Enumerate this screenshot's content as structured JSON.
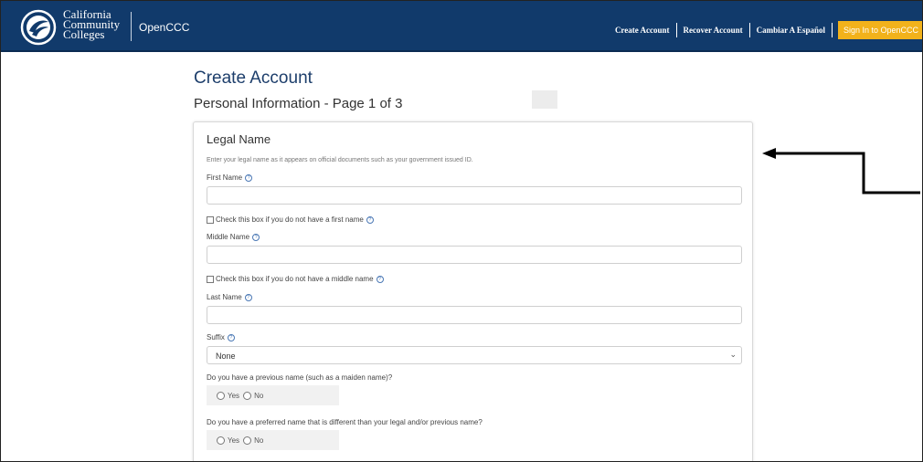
{
  "header": {
    "logo_lines": [
      "California",
      "Community",
      "Colleges"
    ],
    "app_name": "OpenCCC",
    "nav": {
      "create_account": "Create Account",
      "recover_account": "Recover Account",
      "spanish": "Cambiar A Español",
      "sign_in": "Sign In to OpenCCC"
    }
  },
  "page": {
    "title": "Create Account",
    "subtitle": "Personal Information - Page 1 of 3"
  },
  "form": {
    "section_title": "Legal Name",
    "hint": "Enter your legal name as it appears on official documents such as your government issued ID.",
    "first_name_label": "First Name",
    "first_name_value": "",
    "no_first_name_label": "Check this box if you do not have a first name",
    "middle_name_label": "Middle Name",
    "middle_name_value": "",
    "no_middle_name_label": "Check this box if you do not have a middle name",
    "last_name_label": "Last Name",
    "last_name_value": "",
    "suffix_label": "Suffix",
    "suffix_value": "None",
    "previous_name_question": "Do you have a previous name (such as a maiden name)?",
    "preferred_name_question": "Do you have a preferred name that is different than your legal and/or previous name?",
    "yes_label": "Yes",
    "no_label": "No",
    "help_glyph": "?"
  },
  "colors": {
    "header_bg": "#113a6b",
    "sign_in_bg": "#f2b21b",
    "title_color": "#1d3e6b"
  }
}
